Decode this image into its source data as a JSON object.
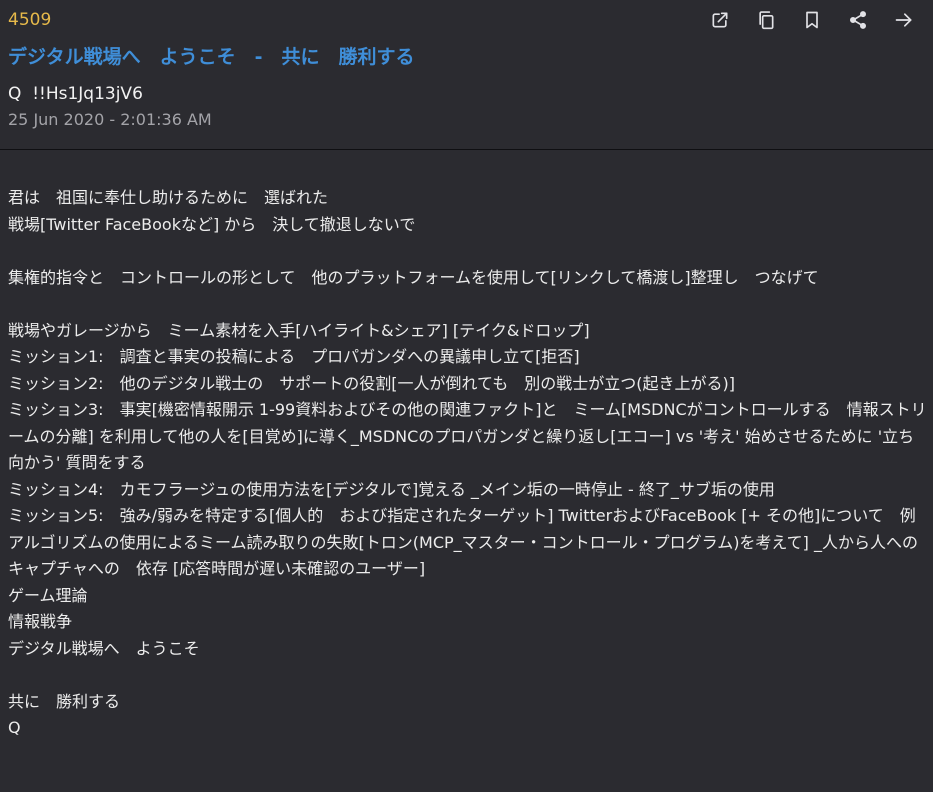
{
  "post": {
    "number": "4509",
    "title": "デジタル戦場へ　ようこそ　-　共に　勝利する",
    "author": "Q  !!Hs1Jq13jV6",
    "timestamp": "25 Jun 2020 - 2:01:36 AM"
  },
  "toolbar": [
    {
      "name": "open-external-icon"
    },
    {
      "name": "copy-icon"
    },
    {
      "name": "bookmark-icon"
    },
    {
      "name": "share-icon"
    },
    {
      "name": "forward-icon"
    }
  ],
  "body_lines": [
    "君は　祖国に奉仕し助けるために　選ばれた",
    "戦場[Twitter FaceBookなど] から　決して撤退しないで",
    "",
    "集権的指令と　コントロールの形として　他のプラットフォームを使用して[リンクして橋渡し]整理し　つなげて",
    "",
    "戦場やガレージから　ミーム素材を入手[ハイライト&シェア] [テイク&ドロップ]",
    "ミッション1:　調査と事実の投稿による　プロパガンダへの異議申し立て[拒否]",
    "ミッション2:　他のデジタル戦士の　サポートの役割[一人が倒れても　別の戦士が立つ(起き上がる)]",
    "ミッション3:　事実[機密情報開示 1-99資料およびその他の関連ファクト]と　ミーム[MSDNCがコントロールする　情報ストリームの分離] を利用して他の人を[目覚め]に導く_MSDNCのプロパガンダと繰り返し[エコー] vs '考え' 始めさせるために '立ち向かう' 質問をする",
    "ミッション4:　カモフラージュの使用方法を[デジタルで]覚える _メイン垢の一時停止 - 終了_サブ垢の使用",
    "ミッション5:　強み/弱みを特定する[個人的　および指定されたターゲット] TwitterおよびFaceBook [+ その他]について　例　アルゴリズムの使用によるミーム読み取りの失敗[トロン(MCP_マスター・コントロール・プログラム)を考えて] _人から人へのキャプチャへの　依存 [応答時間が遅い未確認のユーザー]",
    "ゲーム理論",
    "情報戦争",
    "デジタル戦場へ　ようこそ",
    "",
    "共に　勝利する",
    "Q"
  ]
}
